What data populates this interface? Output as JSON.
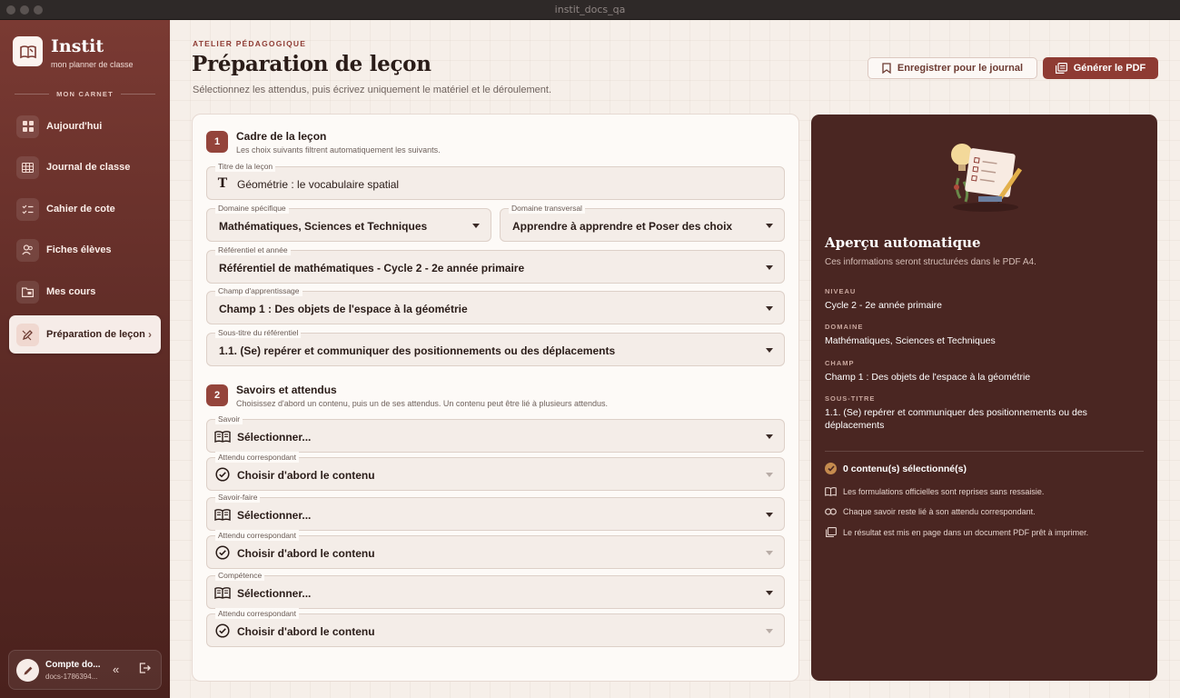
{
  "window": {
    "title": "instit_docs_qa"
  },
  "brand": {
    "name": "Instit",
    "tagline": "mon planner de classe"
  },
  "sidebar": {
    "section_label": "MON CARNET",
    "items": [
      {
        "label": "Aujourd'hui",
        "icon": "grid-icon"
      },
      {
        "label": "Journal de classe",
        "icon": "table-icon"
      },
      {
        "label": "Cahier de cote",
        "icon": "checklist-icon"
      },
      {
        "label": "Fiches élèves",
        "icon": "users-icon"
      },
      {
        "label": "Mes cours",
        "icon": "folder-icon"
      },
      {
        "label": "Préparation de leçon",
        "icon": "edit-icon",
        "active": true
      }
    ],
    "account": {
      "name": "Compte do...",
      "id": "docs-1786394..."
    }
  },
  "header": {
    "eyebrow": "ATELIER PÉDAGOGIQUE",
    "title": "Préparation de leçon",
    "description": "Sélectionnez les attendus, puis écrivez uniquement le matériel et le déroulement.",
    "save_label": "Enregistrer pour le journal",
    "pdf_label": "Générer le PDF"
  },
  "section1": {
    "number": "1",
    "title": "Cadre de la leçon",
    "subtitle": "Les choix suivants filtrent automatiquement les suivants.",
    "titre": {
      "label": "Titre de la leçon",
      "value": "Géométrie : le vocabulaire spatial"
    },
    "domaine_specifique": {
      "label": "Domaine spécifique",
      "value": "Mathématiques, Sciences et Techniques"
    },
    "domaine_transversal": {
      "label": "Domaine transversal",
      "value": "Apprendre à apprendre et Poser des choix"
    },
    "referentiel": {
      "label": "Référentiel et année",
      "value": "Référentiel de mathématiques - Cycle 2 - 2e année primaire"
    },
    "champ": {
      "label": "Champ d'apprentissage",
      "value": "Champ 1 : Des objets de l'espace à la géométrie"
    },
    "sous_titre": {
      "label": "Sous-titre du référentiel",
      "value": "1.1. (Se) repérer et communiquer des positionnements ou des déplacements"
    }
  },
  "section2": {
    "number": "2",
    "title": "Savoirs et attendus",
    "subtitle": "Choisissez d'abord un contenu, puis un de ses attendus. Un contenu peut être lié à plusieurs attendus.",
    "savoir": {
      "label": "Savoir",
      "value": "Sélectionner..."
    },
    "attendu1": {
      "label": "Attendu correspondant",
      "value": "Choisir d'abord le contenu"
    },
    "savoir_faire": {
      "label": "Savoir-faire",
      "value": "Sélectionner..."
    },
    "attendu2": {
      "label": "Attendu correspondant",
      "value": "Choisir d'abord le contenu"
    },
    "competence": {
      "label": "Compétence",
      "value": "Sélectionner..."
    },
    "attendu3": {
      "label": "Attendu correspondant",
      "value": "Choisir d'abord le contenu"
    }
  },
  "preview": {
    "title": "Aperçu automatique",
    "subtitle": "Ces informations seront structurées dans le PDF A4.",
    "niveau_label": "NIVEAU",
    "niveau": "Cycle 2 - 2e année primaire",
    "domaine_label": "DOMAINE",
    "domaine": "Mathématiques, Sciences et Techniques",
    "champ_label": "CHAMP",
    "champ": "Champ 1 : Des objets de l'espace à la géométrie",
    "sous_titre_label": "SOUS-TITRE",
    "sous_titre": "1.1. (Se) repérer et communiquer des positionnements ou des déplacements",
    "count": "0 contenu(s) sélectionné(s)",
    "notes": [
      "Les formulations officielles sont reprises sans ressaisie.",
      "Chaque savoir reste lié à son attendu correspondant.",
      "Le résultat est mis en page dans un document PDF prêt à imprimer."
    ]
  },
  "colors": {
    "accent": "#8e3b33",
    "sidebar": "#6b302a",
    "preview_bg": "#4a2622",
    "background": "#f6efe9"
  }
}
